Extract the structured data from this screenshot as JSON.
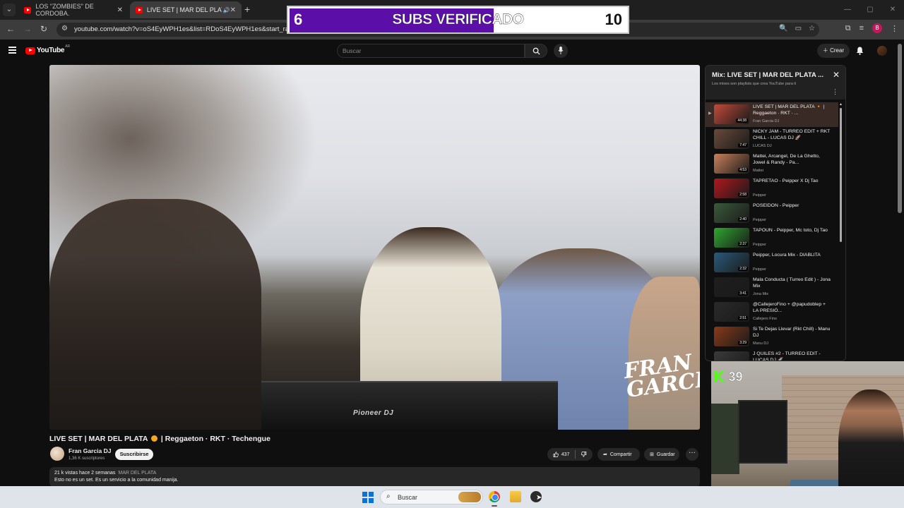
{
  "browser": {
    "tabs": [
      {
        "label": "LOS \"ZOMBIES\" DE CORDOBA.",
        "active": false
      },
      {
        "label": "LIVE SET | MAR DEL PLATA 🔸",
        "active": true
      }
    ],
    "url": "youtube.com/watch?v=oS4EyWPH1es&list=RDoS4EyWPH1es&start_radio",
    "profile_initial": "B"
  },
  "subs_goal": {
    "current": "6",
    "title": "SUBS VERIFICADO",
    "goal": "10",
    "progress_fraction": 0.6,
    "fill_color": "#5b0fa8"
  },
  "masthead": {
    "logo_text": "YouTube",
    "country": "AR",
    "search_placeholder": "Buscar",
    "create_label": "Crear"
  },
  "video": {
    "watermark_line1": "FRAN",
    "watermark_line2": "GARCIA",
    "deck_brand": "Pioneer DJ",
    "title": "LIVE SET | MAR DEL PLATA 🔸 | Reggaeton · RKT · Techengue",
    "title_part1": "LIVE SET | MAR DEL PLATA",
    "title_part2": "| Reggaeton · RKT · Techengue",
    "channel_name": "Fran Garcia DJ",
    "channel_subs": "1,36 K suscriptores",
    "subscribe_label": "Suscribirse",
    "likes": "437",
    "share_label": "Compartir",
    "save_label": "Guardar",
    "views": "21 k vistas",
    "age": "hace 2 semanas",
    "tag": "MAR DEL PLATA",
    "description": "Esto no es un set. Es un servicio a la comunidad manija."
  },
  "playlist": {
    "title": "Mix: LIVE SET | MAR DEL PLATA ...",
    "subtitle": "Los mixes son playlists que crea YouTube para ti",
    "items": [
      {
        "name": "LIVE SET | MAR DEL PLATA 🔸 | Reggaeton · RKT · ...",
        "artist": "Fran Garcia DJ",
        "duration": "44:38",
        "thumb_color": "#c24a3a"
      },
      {
        "name": "NICKY JAM - TURREO EDIT + RKT CHILL - LUCAS DJ 🚀",
        "artist": "LUCAS DJ",
        "duration": "7:47",
        "thumb_color": "#6a4a3a"
      },
      {
        "name": "Mattei, Arcangel, De La Ghetto, Jowel & Randy - Pa...",
        "artist": "Mattei",
        "duration": "4:53",
        "thumb_color": "#c9805a"
      },
      {
        "name": "TAPRETAO - Peipper X Dj Tao",
        "artist": "Peipper",
        "duration": "2:58",
        "thumb_color": "#b0181e"
      },
      {
        "name": "POSEIDON - Peipper",
        "artist": "Peipper",
        "duration": "2:40",
        "thumb_color": "#3a5a3a"
      },
      {
        "name": "TAPOUN - Peipper, Mc toto, Dj Tao",
        "artist": "Peipper",
        "duration": "2:37",
        "thumb_color": "#2fa82f"
      },
      {
        "name": "Peipper, Locura Mix - DIABLITA",
        "artist": "Peipper",
        "duration": "2:32",
        "thumb_color": "#2a5a7a"
      },
      {
        "name": "Mala Conducta ( Turreo Edit ) - Jona Mix",
        "artist": "Jona Mix",
        "duration": "3:41",
        "thumb_color": "#1e1e1e"
      },
      {
        "name": "@CallejeroFino + @papudoblep + LA PRESIÓ...",
        "artist": "Callejero Fino",
        "duration": "2:51",
        "thumb_color": "#2a2a2a"
      },
      {
        "name": "Si Te Dejas Llevar (Rkt Chill) - Manu DJ",
        "artist": "Manu DJ",
        "duration": "3:29",
        "thumb_color": "#8a3a1a"
      },
      {
        "name": "J QUILES #2 - TURREO EDIT - LUCAS DJ 🚀",
        "artist": "",
        "duration": "",
        "thumb_color": "#3a3a3a"
      }
    ]
  },
  "webcam": {
    "kick_count": "39",
    "kick_color": "#53fc18"
  },
  "taskbar": {
    "search_placeholder": "Buscar"
  }
}
